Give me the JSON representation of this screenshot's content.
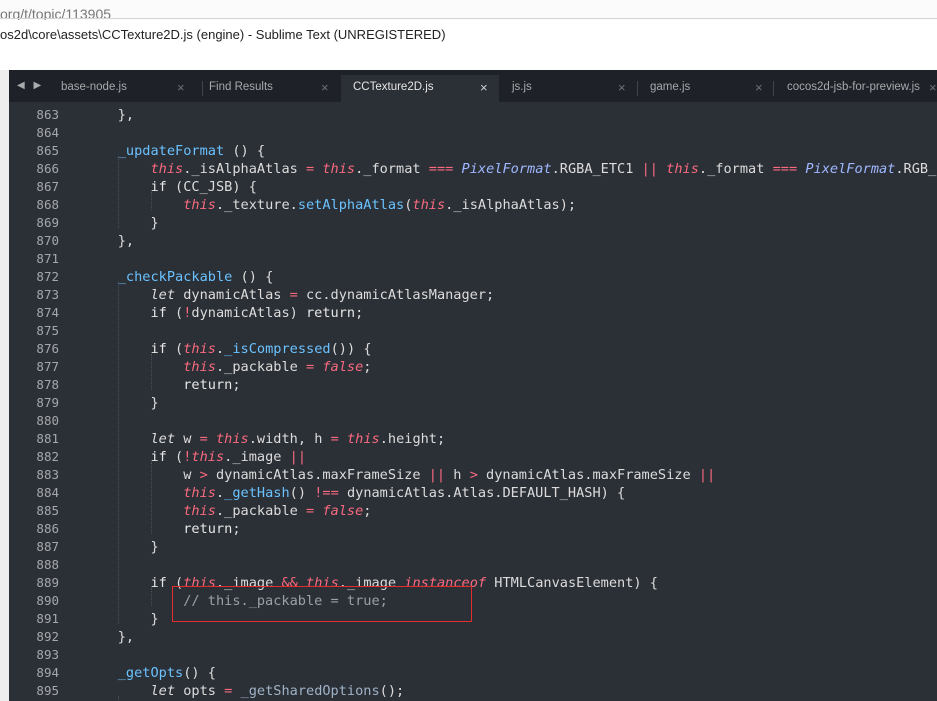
{
  "browser": {
    "url_fragment": "org/t/topic/113905"
  },
  "window": {
    "title": "os2d\\core\\assets\\CCTexture2D.js (engine) - Sublime Text (UNREGISTERED)"
  },
  "tabs": [
    {
      "label": "base-node.js",
      "active": false
    },
    {
      "label": "Find Results",
      "active": false
    },
    {
      "label": "CCTexture2D.js",
      "active": true
    },
    {
      "label": "js.js",
      "active": false
    },
    {
      "label": "game.js",
      "active": false
    },
    {
      "label": "cocos2d-jsb-for-preview.js",
      "active": false
    }
  ],
  "tab_close_glyph": "×",
  "nav_arrows": "◀ ▶",
  "line_numbers": [
    "863",
    "864",
    "865",
    "866",
    "867",
    "868",
    "869",
    "870",
    "871",
    "872",
    "873",
    "874",
    "875",
    "876",
    "877",
    "878",
    "879",
    "880",
    "881",
    "882",
    "883",
    "884",
    "885",
    "886",
    "887",
    "888",
    "889",
    "890",
    "891",
    "892",
    "893",
    "894",
    "895"
  ],
  "code": [
    "    },",
    "",
    "    _updateFormat () {",
    "        this._isAlphaAtlas = this._format === PixelFormat.RGBA_ETC1 || this._format === PixelFormat.RGB_",
    "        if (CC_JSB) {",
    "            this._texture.setAlphaAtlas(this._isAlphaAtlas);",
    "        }",
    "    },",
    "",
    "    _checkPackable () {",
    "        let dynamicAtlas = cc.dynamicAtlasManager;",
    "        if (!dynamicAtlas) return;",
    "",
    "        if (this._isCompressed()) {",
    "            this._packable = false;",
    "            return;",
    "        }",
    "",
    "        let w = this.width, h = this.height;",
    "        if (!this._image ||",
    "            w > dynamicAtlas.maxFrameSize || h > dynamicAtlas.maxFrameSize ||",
    "            this._getHash() !== dynamicAtlas.Atlas.DEFAULT_HASH) {",
    "            this._packable = false;",
    "            return;",
    "        }",
    "",
    "        if (this._image && this._image instanceof HTMLCanvasElement) {",
    "            // this._packable = true;",
    "        }",
    "    },",
    "",
    "    _getOpts() {",
    "        let opts = _getSharedOptions();"
  ],
  "colors": {
    "editor_bg": "#2b2f36",
    "tabbar_bg": "#1e2127",
    "keyword_this": "#f96a7f",
    "function_name": "#6ac2ff",
    "highlight_box": "#e12d2d"
  }
}
